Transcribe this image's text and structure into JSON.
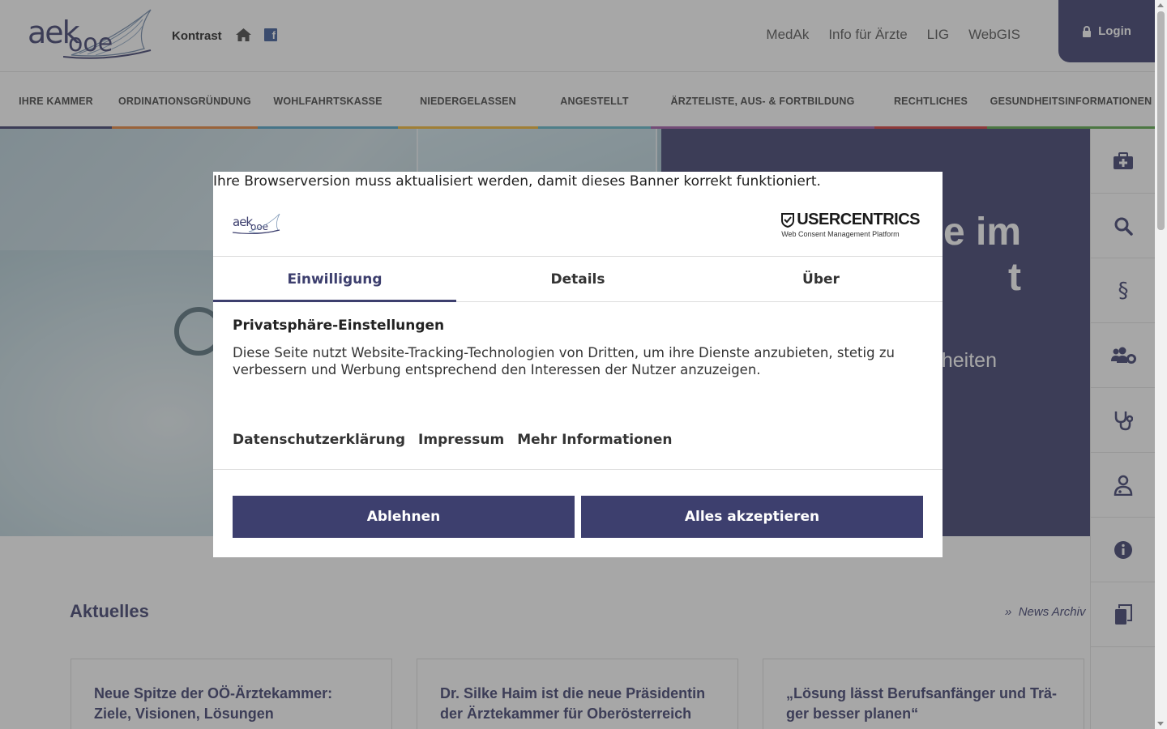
{
  "header": {
    "logo_text": "aek",
    "logo_sub": "ooe",
    "kontrast": "Kontrast",
    "facebook_glyph": "f",
    "toplinks": [
      "MedAk",
      "Info für Ärzte",
      "LIG",
      "WebGIS"
    ],
    "login": "Login"
  },
  "nav": {
    "items": [
      {
        "label": "IHRE KAMMER",
        "color": "#3d3f6e"
      },
      {
        "label": "ORDINATIONSGRÜNDUNG",
        "color": "#e8833a"
      },
      {
        "label": "WOHLFAHRTSKASSE",
        "color": "#4fa3c7"
      },
      {
        "label": "NIEDERGELASSEN",
        "color": "#f2b632"
      },
      {
        "label": "ANGESTELLT",
        "color": "#5fb7c9"
      },
      {
        "label": "ÄRZTELISTE, AUS- & FORTBILDUNG",
        "color": "#a05aa8"
      },
      {
        "label": "RECHTLICHES",
        "color": "#d13a3a"
      },
      {
        "label": "GESUNDHEITSINFORMATIONEN",
        "color": "#5aa84a"
      }
    ]
  },
  "hero": {
    "title": "e im\nt",
    "subtitle": "heiten"
  },
  "rail": {
    "icons": [
      "medkit-icon",
      "search-icon",
      "paragraph-icon",
      "users-cog-icon",
      "stethoscope-icon",
      "doctor-icon",
      "info-icon",
      "copy-icon"
    ]
  },
  "news": {
    "title": "Aktuelles",
    "archiv": "News Archiv",
    "archiv_prefix": "»",
    "cards": [
      {
        "title": "Neue Spitze der OÖ-Ärztekammer: Ziele, Visionen, Lösungen"
      },
      {
        "title": "Dr. Silke Haim ist die neue Präsidentin der Ärztekammer für Oberösterreich"
      },
      {
        "title": "„Lösung lässt Berufsanfänger und Trä-ger besser planen“"
      }
    ]
  },
  "modal": {
    "warning": "Ihre Browserversion muss aktualisiert werden, damit dieses Banner korrekt funktioniert.",
    "logo_text": "aekooe",
    "provider": "USERCENTRICS",
    "provider_sub": "Web Consent Management Platform",
    "tabs": [
      "Einwilligung",
      "Details",
      "Über"
    ],
    "heading": "Privatsphäre-Einstellungen",
    "text": "Diese Seite nutzt Website-Tracking-Technologien von Dritten, um ihre Dienste anzubieten, stetig zu verbessern und Werbung entsprechend den Interessen der Nutzer anzuzeigen.",
    "links": [
      "Datenschutzerklärung",
      "Impressum",
      "Mehr Informationen"
    ],
    "deny": "Ablehnen",
    "accept": "Alles akzeptieren"
  },
  "colors": {
    "brand": "#3d3f6e",
    "overlay": "rgba(60,60,60,0.45)"
  }
}
